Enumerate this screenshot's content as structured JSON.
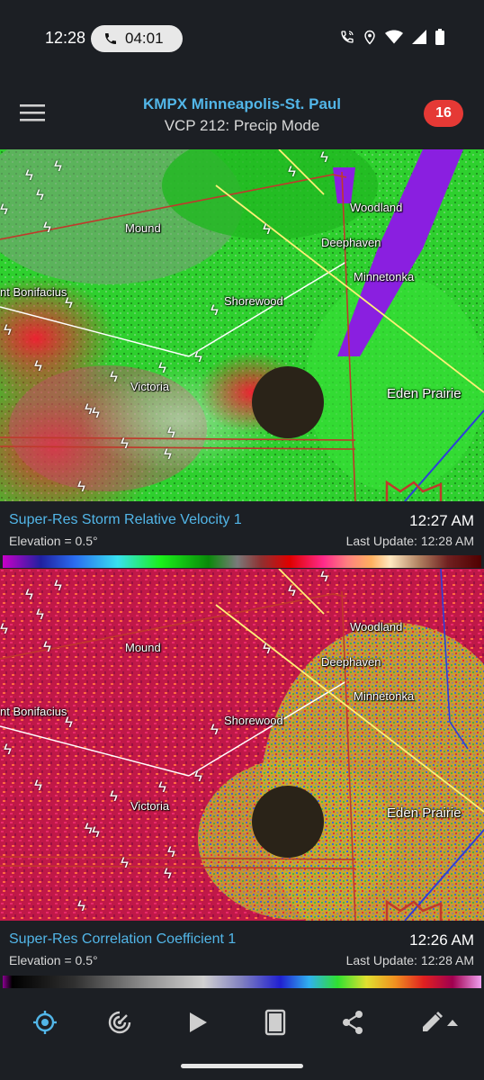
{
  "status_bar": {
    "time": "12:28",
    "call_timer": "04:01",
    "icons": [
      "wifi-calling-icon",
      "location-icon",
      "wifi-icon",
      "cell-signal-icon",
      "battery-icon"
    ]
  },
  "header": {
    "title": "KMPX Minneapolis-St. Paul",
    "subtitle": "VCP 212: Precip Mode",
    "alert_count": "16"
  },
  "map_labels": {
    "mound": "Mound",
    "woodland": "Woodland",
    "deephaven": "Deephaven",
    "minnetonka": "Minnetonka",
    "st_bonifacius": "nt Bonifacius",
    "shorewood": "Shorewood",
    "victoria": "Victoria",
    "eden_prairie": "Eden Prairie"
  },
  "panel_1": {
    "product": "Super-Res Storm Relative Velocity 1",
    "time": "12:27 AM",
    "elevation": "Elevation = 0.5°",
    "last_update": "Last Update: 12:28 AM"
  },
  "panel_2": {
    "product": "Super-Res Correlation Coefficient 1",
    "time": "12:26 AM",
    "elevation": "Elevation = 0.5°",
    "last_update": "Last Update: 12:28 AM"
  },
  "colors": {
    "accent": "#52b6e8",
    "badge": "#e53935",
    "background": "#1c1f24"
  },
  "bottom_nav": {
    "icons": [
      "location-target-icon",
      "radar-icon",
      "play-icon",
      "layers-icon",
      "share-icon",
      "draw-icon"
    ]
  }
}
